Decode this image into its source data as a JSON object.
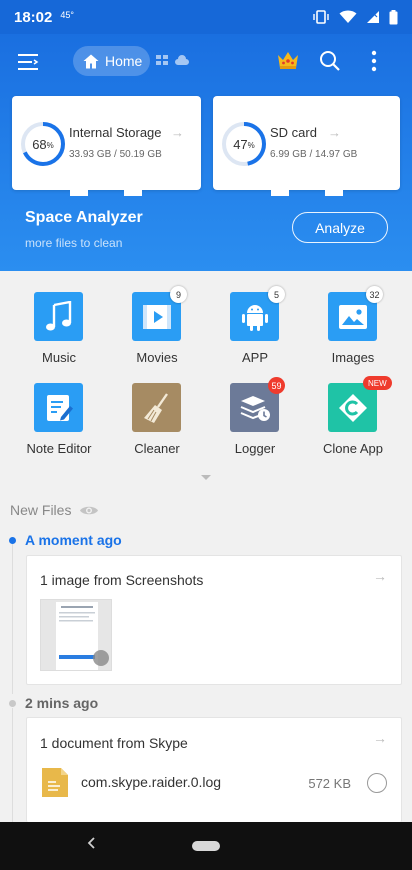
{
  "status_bar": {
    "time": "18:02",
    "temperature": "45°"
  },
  "toolbar": {
    "home_label": "Home"
  },
  "storage": {
    "internal": {
      "title": "Internal Storage",
      "percent": "68",
      "pct_symbol": "%",
      "usage": "33.93 GB / 50.19 GB",
      "arrow": "→",
      "ring_fraction": 0.68
    },
    "sd": {
      "title": "SD card",
      "percent": "47",
      "pct_symbol": "%",
      "usage": "6.99 GB / 14.97 GB",
      "arrow": "→",
      "ring_fraction": 0.47
    }
  },
  "analyzer": {
    "title": "Space Analyzer",
    "subtitle": "more files to clean",
    "button_label": "Analyze"
  },
  "categories": [
    {
      "label": "Music",
      "icon": "music-note-icon",
      "badge": ""
    },
    {
      "label": "Movies",
      "icon": "video-icon",
      "badge": "9"
    },
    {
      "label": "APP",
      "icon": "android-icon",
      "badge": "5"
    },
    {
      "label": "Images",
      "icon": "image-icon",
      "badge": "32"
    },
    {
      "label": "Note Editor",
      "icon": "note-edit-icon",
      "badge": ""
    },
    {
      "label": "Cleaner",
      "icon": "broom-icon",
      "badge": ""
    },
    {
      "label": "Logger",
      "icon": "logger-icon",
      "badge": "59"
    },
    {
      "label": "Clone App",
      "icon": "clone-icon",
      "badge": "NEW"
    }
  ],
  "new_files": {
    "header": "New Files",
    "groups": [
      {
        "time": "A moment ago",
        "card_title": "1 image from Screenshots",
        "arrow": "→"
      },
      {
        "time": "2 mins ago",
        "card_title": "1 document from Skype",
        "arrow": "→",
        "file_name": "com.skype.raider.0.log",
        "file_size": "572 KB"
      }
    ]
  },
  "colors": {
    "primary": "#1a6fe0",
    "accent_blue": "#1a73e8",
    "badge_red": "#ef3b2d",
    "ring_track": "#dde6f3"
  }
}
